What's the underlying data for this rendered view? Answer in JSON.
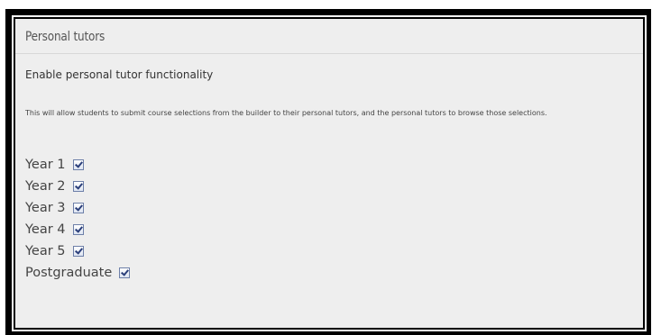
{
  "section": {
    "title": "Personal tutors"
  },
  "setting": {
    "label": "Enable personal tutor functionality",
    "description": "This will allow students to submit course selections from the builder to their personal tutors, and the personal tutors to browse those selections."
  },
  "years": [
    {
      "label": "Year 1",
      "checked": true
    },
    {
      "label": "Year 2",
      "checked": true
    },
    {
      "label": "Year 3",
      "checked": true
    },
    {
      "label": "Year 4",
      "checked": true
    },
    {
      "label": "Year 5",
      "checked": true
    },
    {
      "label": "Postgraduate",
      "checked": true
    }
  ],
  "colors": {
    "frame": "#000000",
    "panel_background": "#eeeeee",
    "checkbox_border": "#6d7fa8",
    "checkmark": "#2b3f7a"
  }
}
